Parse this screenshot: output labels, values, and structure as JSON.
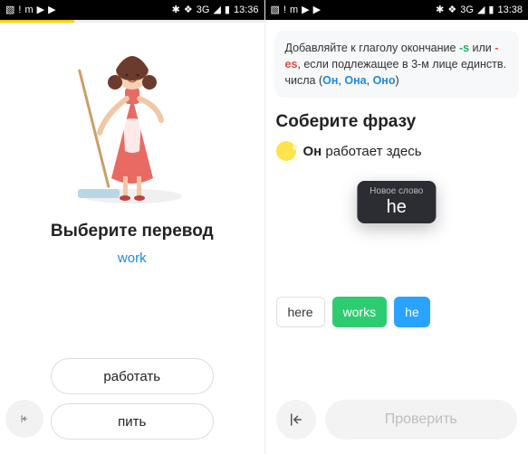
{
  "left": {
    "status": {
      "time": "13:36",
      "network": "3G"
    },
    "title": "Выберите перевод",
    "word": "work",
    "options": [
      "работать",
      "пить"
    ]
  },
  "right": {
    "status": {
      "time": "13:38",
      "network": "3G"
    },
    "tip": {
      "prefix": "Добавляйте к глаголу окончание ",
      "suffix_s": "-s",
      "or": " или ",
      "suffix_es": "-es",
      "line2": ", если подлежащее в 3-м лице единств. числа (",
      "pr1": "Он",
      "pr2": "Она",
      "pr3": "Оно",
      "close": ")"
    },
    "title": "Соберите фразу",
    "phrase": {
      "bold": "Он",
      "rest": " работает здесь"
    },
    "tooltip": {
      "label": "Новое слово",
      "word": "he"
    },
    "chips": {
      "a": "here",
      "b": "works",
      "c": "he"
    },
    "check": "Проверить"
  }
}
